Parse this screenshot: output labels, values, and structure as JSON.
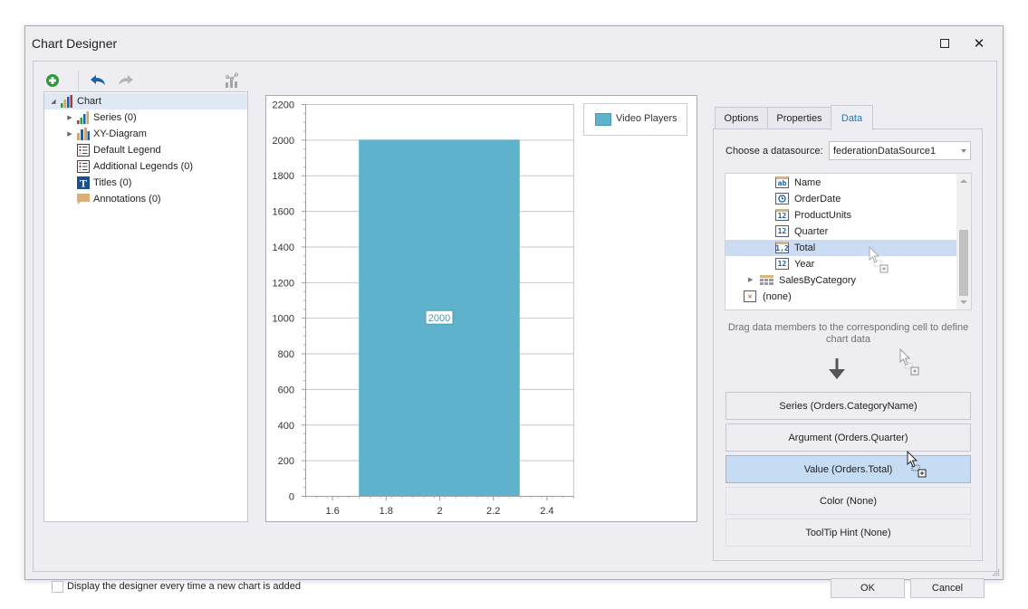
{
  "window": {
    "title": "Chart Designer",
    "maximize_icon": "maximize-icon",
    "close_icon": "close-icon"
  },
  "toolbar": {
    "buttons": [
      {
        "name": "add-chart-element",
        "icon": "plus-circle-icon",
        "enabled": true
      },
      {
        "name": "undo",
        "icon": "undo-icon",
        "enabled": true
      },
      {
        "name": "redo",
        "icon": "redo-icon",
        "enabled": false
      },
      {
        "name": "chart-wizard",
        "icon": "chart-scatter-bar-icon",
        "enabled": false
      }
    ]
  },
  "tree": {
    "items": [
      {
        "label": "Chart",
        "icon": "chart-icon",
        "level": 0,
        "expander": "expanded",
        "selected": true
      },
      {
        "label": "Series (0)",
        "icon": "series-icon",
        "level": 1,
        "expander": "collapsed"
      },
      {
        "label": "XY-Diagram",
        "icon": "diagram-icon",
        "level": 1,
        "expander": "collapsed"
      },
      {
        "label": "Default Legend",
        "icon": "legend-icon",
        "level": 1,
        "expander": "none"
      },
      {
        "label": "Additional Legends (0)",
        "icon": "legend-icon",
        "level": 1,
        "expander": "none"
      },
      {
        "label": "Titles (0)",
        "icon": "title-icon",
        "level": 1,
        "expander": "none"
      },
      {
        "label": "Annotations (0)",
        "icon": "annotation-icon",
        "level": 1,
        "expander": "none"
      }
    ]
  },
  "chart_data": {
    "type": "bar",
    "title": "",
    "xlabel": "",
    "ylabel": "",
    "x_ticks": [
      "1.6",
      "1.8",
      "2",
      "2.2",
      "2.4"
    ],
    "x_tick_values": [
      1.6,
      1.8,
      2,
      2.2,
      2.4
    ],
    "y_ticks": [
      "0",
      "200",
      "400",
      "600",
      "800",
      "1000",
      "1200",
      "1400",
      "1600",
      "1800",
      "2000",
      "2200"
    ],
    "y_tick_values": [
      0,
      200,
      400,
      600,
      800,
      1000,
      1200,
      1400,
      1600,
      1800,
      2000,
      2200
    ],
    "xlim": [
      1.5,
      2.5
    ],
    "ylim": [
      0,
      2200
    ],
    "grid": true,
    "legend_position": "top-right",
    "series": [
      {
        "name": "Video Players",
        "color": "#5fb2cb",
        "points": [
          {
            "x": 2,
            "y": 2000,
            "bar_width": 0.6,
            "label": "2000"
          }
        ]
      }
    ]
  },
  "right_panel": {
    "tabs": [
      {
        "label": "Options",
        "active": false
      },
      {
        "label": "Properties",
        "active": false
      },
      {
        "label": "Data",
        "active": true
      }
    ],
    "datasource_label": "Choose a datasource:",
    "datasource_value": "federationDataSource1",
    "fields": [
      {
        "label": "Name",
        "type_icon": "ab",
        "icon": "string-field-icon",
        "key": true,
        "indent": 2
      },
      {
        "label": "OrderDate",
        "type_icon": "clock",
        "icon": "date-field-icon",
        "key": false,
        "indent": 2
      },
      {
        "label": "ProductUnits",
        "type_icon": "12",
        "icon": "integer-field-icon",
        "key": true,
        "indent": 2
      },
      {
        "label": "Quarter",
        "type_icon": "12",
        "icon": "integer-field-icon",
        "key": false,
        "indent": 2
      },
      {
        "label": "Total",
        "type_icon": "1,2",
        "icon": "decimal-field-icon",
        "key": true,
        "indent": 2,
        "selected": true
      },
      {
        "label": "Year",
        "type_icon": "12",
        "icon": "integer-field-icon",
        "key": false,
        "indent": 2
      },
      {
        "label": "SalesByCategory",
        "type_icon": "table",
        "icon": "table-icon",
        "key": false,
        "indent": 1,
        "expander": "collapsed"
      },
      {
        "label": "(none)",
        "type_icon": "x",
        "icon": "none-icon",
        "key": false,
        "indent": 0
      }
    ],
    "hint": "Drag data members to the corresponding cell to define chart data",
    "slots": [
      {
        "label": "Series (Orders.CategoryName)",
        "state": "filled"
      },
      {
        "label": "Argument (Orders.Quarter)",
        "state": "filled"
      },
      {
        "label": "Value (Orders.Total)",
        "state": "highlighted"
      },
      {
        "label": "Color (None)",
        "state": "empty"
      },
      {
        "label": "ToolTip Hint (None)",
        "state": "empty"
      }
    ]
  },
  "footer": {
    "checkbox_label": "Display the designer every time a new chart is added",
    "checkbox_checked": false,
    "ok_label": "OK",
    "cancel_label": "Cancel"
  }
}
